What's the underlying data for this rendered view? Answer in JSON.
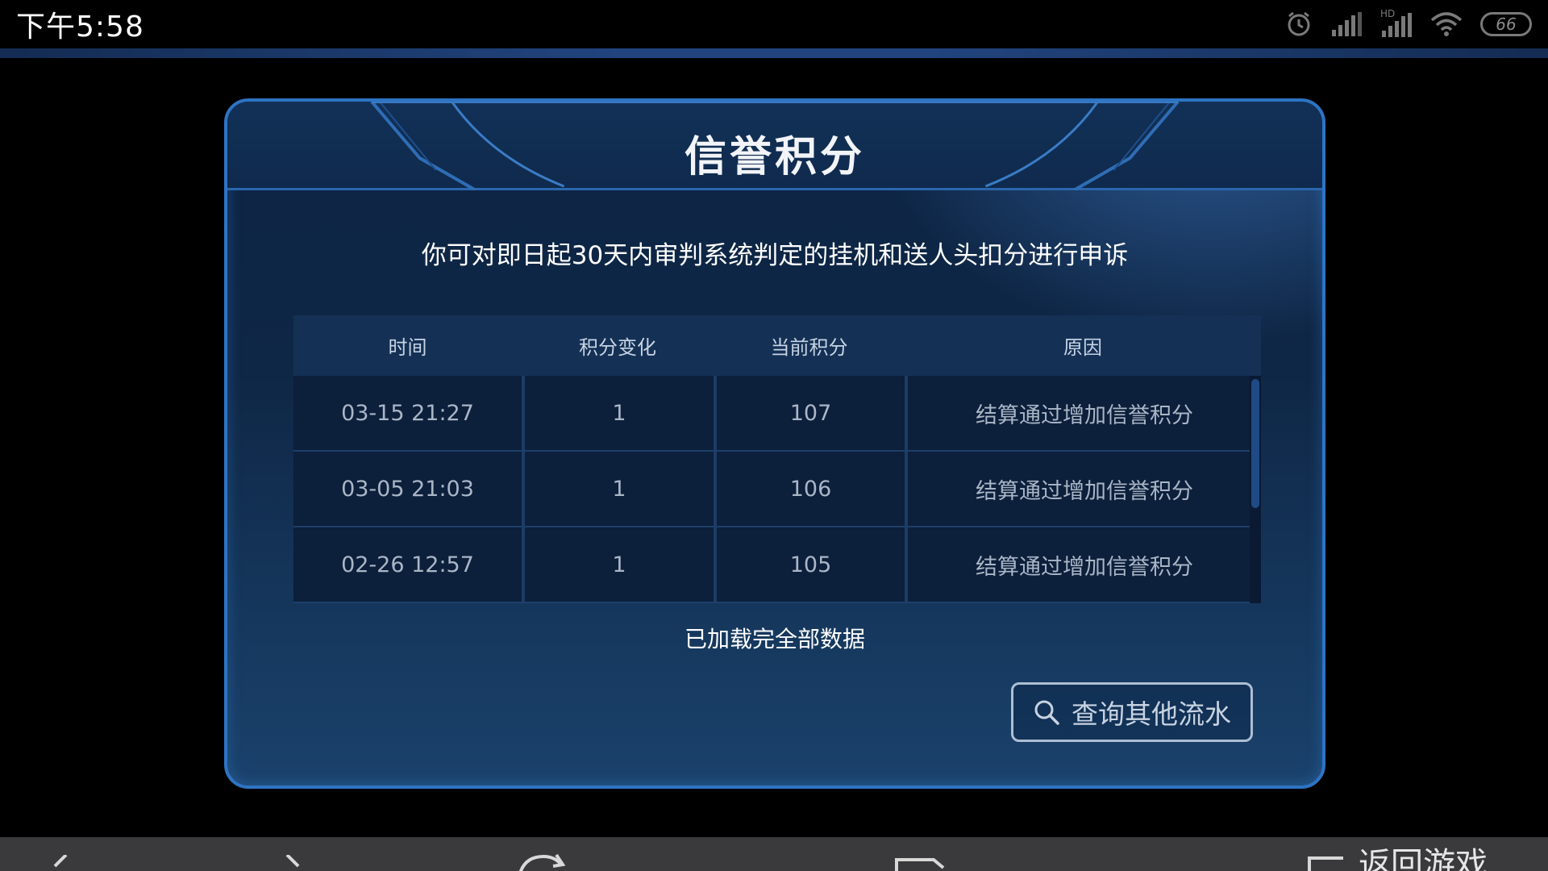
{
  "status_bar": {
    "time": "下午5:58",
    "battery": "66",
    "hd_label": "HD"
  },
  "dialog": {
    "title": "信誉积分",
    "subtitle": "你可对即日起30天内审判系统判定的挂机和送人头扣分进行申诉",
    "table": {
      "headers": [
        "时间",
        "积分变化",
        "当前积分",
        "原因"
      ],
      "rows": [
        {
          "time": "03-15  21:27",
          "change": "1",
          "current": "107",
          "reason": "结算通过增加信誉积分"
        },
        {
          "time": "03-05  21:03",
          "change": "1",
          "current": "106",
          "reason": "结算通过增加信誉积分"
        },
        {
          "time": "02-26  12:57",
          "change": "1",
          "current": "105",
          "reason": "结算通过增加信誉积分"
        }
      ]
    },
    "loaded_text": "已加载完全部数据",
    "query_button_label": "查询其他流水"
  },
  "bottom_bar": {
    "partial_label": "返回游戏"
  },
  "colors": {
    "dialog_border": "#2e74c4",
    "table_row_bg": "#0c1f3b",
    "table_head_bg": "#143055"
  }
}
